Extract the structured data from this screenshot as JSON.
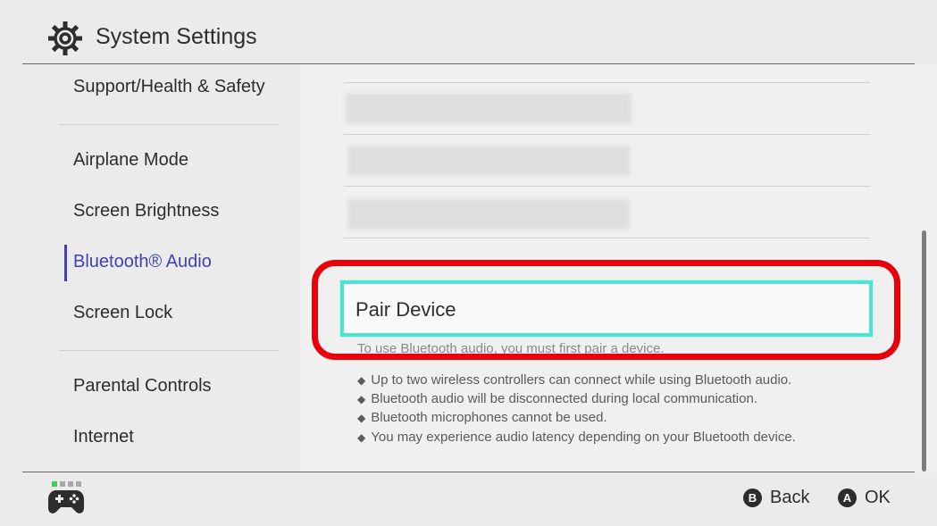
{
  "header": {
    "title": "System Settings",
    "icon": "gear-icon"
  },
  "sidebar": {
    "items": [
      {
        "label": "Support/Health & Safety",
        "selected": false
      },
      {
        "label": "Airplane Mode",
        "selected": false
      },
      {
        "label": "Screen Brightness",
        "selected": false
      },
      {
        "label": "Bluetooth® Audio",
        "selected": true
      },
      {
        "label": "Screen Lock",
        "selected": false
      },
      {
        "label": "Parental Controls",
        "selected": false
      },
      {
        "label": "Internet",
        "selected": false
      }
    ]
  },
  "main": {
    "pair_button_label": "Pair Device",
    "pair_description": "To use Bluetooth audio, you must first pair a device.",
    "notes": [
      "Up to two wireless controllers can connect while using Bluetooth audio.",
      "Bluetooth audio will be disconnected during local communication.",
      "Bluetooth microphones cannot be used.",
      "You may experience audio latency depending on your Bluetooth device."
    ],
    "bullet": "◆"
  },
  "footer": {
    "back": {
      "key": "B",
      "label": "Back"
    },
    "ok": {
      "key": "A",
      "label": "OK"
    },
    "controller_icon": "gamepad-icon"
  },
  "colors": {
    "accent": "#3f42b5",
    "focus_border": "#4ee3d0",
    "highlight_ring": "#e8000b",
    "player_indicator": "#39d353"
  }
}
